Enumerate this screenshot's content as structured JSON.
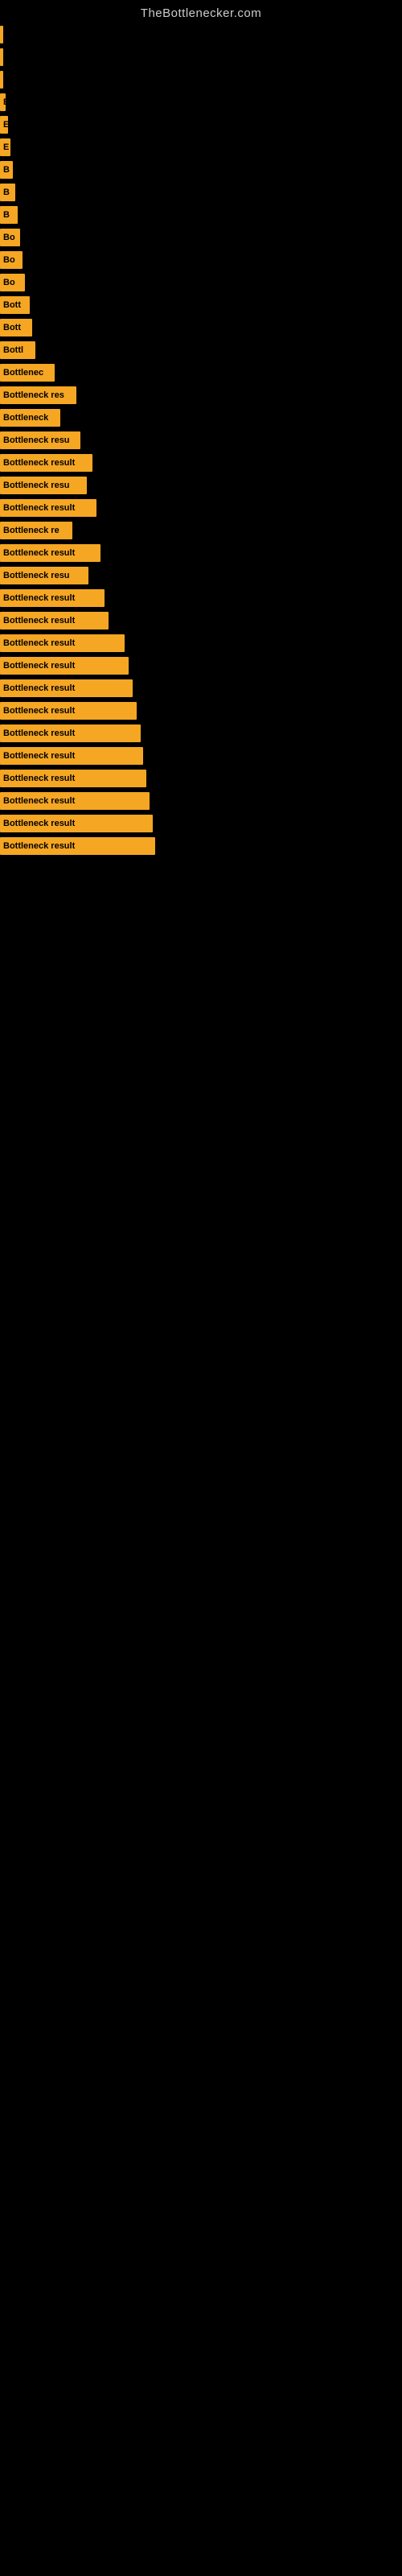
{
  "site": {
    "title": "TheBottlenecker.com"
  },
  "bars": [
    {
      "label": "",
      "width": 2,
      "row": 1
    },
    {
      "label": "",
      "width": 2,
      "row": 2
    },
    {
      "label": "",
      "width": 2,
      "row": 3
    },
    {
      "label": "E",
      "width": 7,
      "row": 4
    },
    {
      "label": "E",
      "width": 10,
      "row": 5
    },
    {
      "label": "E",
      "width": 13,
      "row": 6
    },
    {
      "label": "B",
      "width": 16,
      "row": 7
    },
    {
      "label": "B",
      "width": 19,
      "row": 8
    },
    {
      "label": "B",
      "width": 22,
      "row": 9
    },
    {
      "label": "Bo",
      "width": 25,
      "row": 10
    },
    {
      "label": "Bo",
      "width": 28,
      "row": 11
    },
    {
      "label": "Bo",
      "width": 31,
      "row": 12
    },
    {
      "label": "Bott",
      "width": 37,
      "row": 13
    },
    {
      "label": "Bott",
      "width": 40,
      "row": 14
    },
    {
      "label": "Bottl",
      "width": 44,
      "row": 15
    },
    {
      "label": "Bottlenec",
      "width": 68,
      "row": 16
    },
    {
      "label": "Bottleneck res",
      "width": 95,
      "row": 17
    },
    {
      "label": "Bottleneck",
      "width": 75,
      "row": 18
    },
    {
      "label": "Bottleneck resu",
      "width": 100,
      "row": 19
    },
    {
      "label": "Bottleneck result",
      "width": 115,
      "row": 20
    },
    {
      "label": "Bottleneck resu",
      "width": 108,
      "row": 21
    },
    {
      "label": "Bottleneck result",
      "width": 120,
      "row": 22
    },
    {
      "label": "Bottleneck re",
      "width": 90,
      "row": 23
    },
    {
      "label": "Bottleneck result",
      "width": 125,
      "row": 24
    },
    {
      "label": "Bottleneck resu",
      "width": 110,
      "row": 25
    },
    {
      "label": "Bottleneck result",
      "width": 130,
      "row": 26
    },
    {
      "label": "Bottleneck result",
      "width": 135,
      "row": 27
    },
    {
      "label": "Bottleneck result",
      "width": 155,
      "row": 28
    },
    {
      "label": "Bottleneck result",
      "width": 160,
      "row": 29
    },
    {
      "label": "Bottleneck result",
      "width": 165,
      "row": 30
    },
    {
      "label": "Bottleneck result",
      "width": 170,
      "row": 31
    },
    {
      "label": "Bottleneck result",
      "width": 175,
      "row": 32
    },
    {
      "label": "Bottleneck result",
      "width": 178,
      "row": 33
    },
    {
      "label": "Bottleneck result",
      "width": 182,
      "row": 34
    },
    {
      "label": "Bottleneck result",
      "width": 186,
      "row": 35
    },
    {
      "label": "Bottleneck result",
      "width": 190,
      "row": 36
    },
    {
      "label": "Bottleneck result",
      "width": 193,
      "row": 37
    }
  ]
}
